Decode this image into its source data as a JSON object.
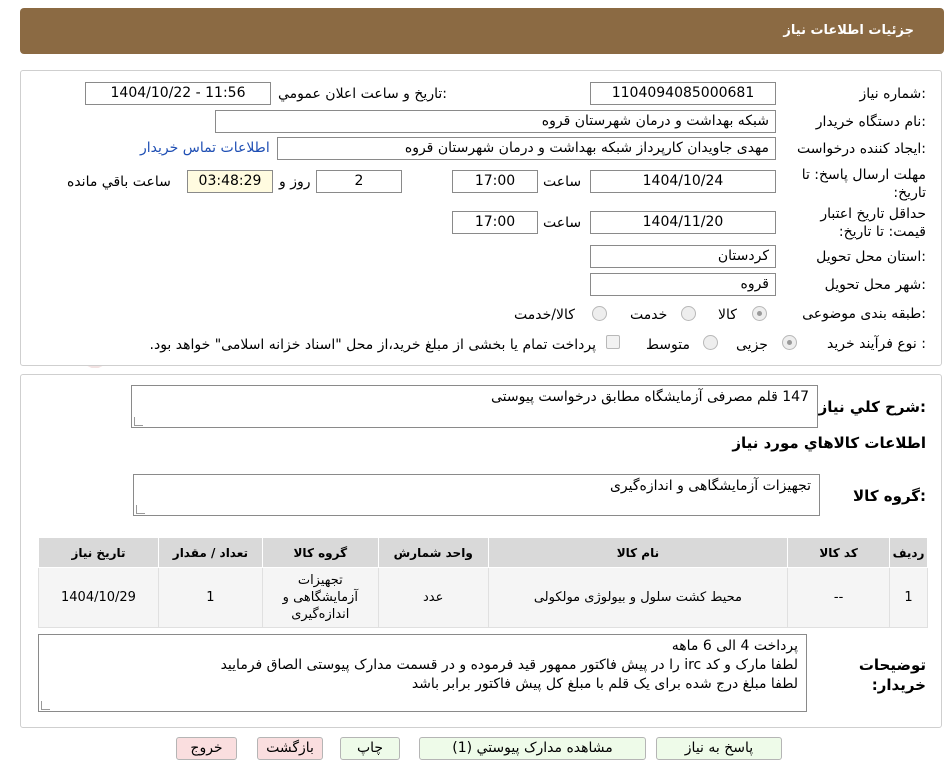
{
  "header": {
    "title": "جزئیات اطلاعات نیاز"
  },
  "fields": {
    "need_number_label": "شماره نیاز:",
    "need_number": "1104094085000681",
    "announce_label": "تاریخ و ساعت اعلان عمومي:",
    "announce_value": "1404/10/22 - 11:56",
    "buyer_org_label": "نام دستگاه خريدار:",
    "buyer_org": "شبکه بهداشت و درمان شهرستان قروه",
    "creator_label": "ايجاد كننده درخواست:",
    "creator": "مهدی جاویدان کارپرداز شبکه بهداشت و درمان شهرستان قروه",
    "contact_link": "اطلاعات تماس خريدار",
    "deadline_label": "مهلت ارسال پاسخ: تا تاریخ:",
    "deadline_date": "1404/10/24",
    "hour_label": "ساعت",
    "deadline_time": "17:00",
    "days_count": "2",
    "day_label": "روز و",
    "remaining_time": "03:48:29",
    "remaining_label": "ساعت باقي مانده",
    "validity_label": "حداقل تاريخ اعتبار قيمت: تا تاريخ:",
    "validity_date": "1404/11/20",
    "validity_time": "17:00",
    "province_label": "استان محل تحويل:",
    "province": "کردستان",
    "city_label": "شهر محل تحويل:",
    "city": "قروه",
    "category_label": "طبقه بندی موضوعی:",
    "category_options": [
      "کالا",
      "خدمت",
      "کالا/خدمت"
    ],
    "process_label": "نوع فرآیند خرید :",
    "process_options": [
      "جزیی",
      "متوسط"
    ],
    "process_note": "پرداخت تمام یا بخشی از مبلغ خرید،از محل \"اسناد خزانه اسلامی\" خواهد بود."
  },
  "summary": {
    "label": "شرح کلي نياز:",
    "text": "147 قلم مصرفی آزمایشگاه مطابق درخواست پیوستی",
    "goods_info_title": "اطلاعات کالاهاي مورد نياز",
    "group_label": "گروه کالا:",
    "group_value": "تجهیزات آزمایشگاهی و اندازه‌گیری"
  },
  "table": {
    "headers": [
      "رديف",
      "کد کالا",
      "نام کالا",
      "واحد شمارش",
      "گروه کالا",
      "تعداد / مقدار",
      "تاريخ نياز"
    ],
    "rows": [
      [
        "1",
        "--",
        "محیط کشت سلول و بیولوژی مولکولی",
        "عدد",
        "تجهیزات آزمایشگاهی و اندازه‌گیری",
        "1",
        "1404/10/29"
      ]
    ]
  },
  "notes": {
    "label": "توضیحات خریدار:",
    "lines": [
      "پرداخت 4 الی 6 ماهه",
      "لطفا مارک و کد irc  را در پیش فاکتور ممهور قید فرموده و در قسمت مدارک پیوستی الصاق فرمایید",
      "لطفا مبلغ درج شده برای یک قلم با مبلغ کل پیش فاکتور برابر باشد"
    ]
  },
  "buttons": {
    "reply": "پاسخ به نیاز",
    "attachments": "مشاهده مدارک پيوستي (1)",
    "print": "چاپ",
    "back": "بازگشت",
    "exit": "خروج"
  },
  "watermark": "AriaTender.neT",
  "colors": {
    "header": "#8b6a43",
    "link": "#1f4fb4",
    "green_button": "#eefbe9",
    "pink_button": "#fadedf",
    "remaining_bg": "#fffbe0"
  }
}
